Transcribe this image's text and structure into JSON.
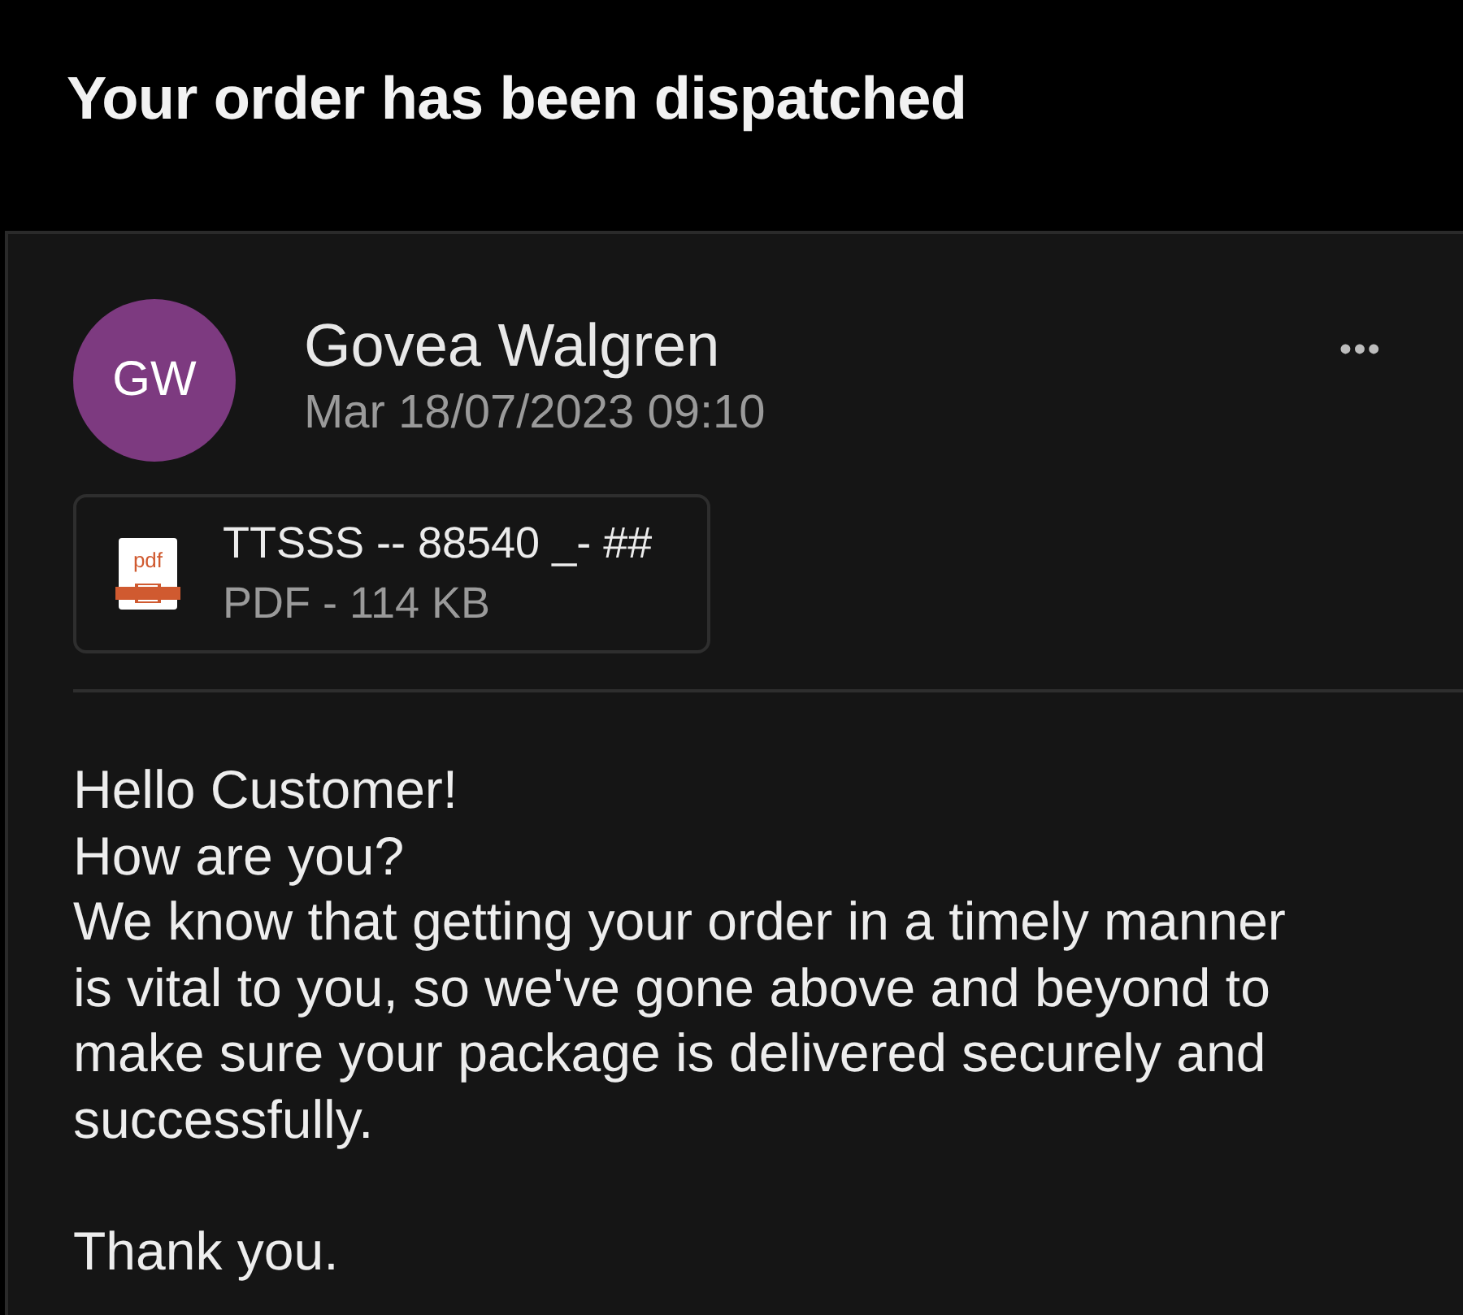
{
  "header": {
    "title": "Your order has been dispatched"
  },
  "message": {
    "sender": {
      "initials": "GW",
      "name": "Govea Walgren",
      "color": "#7d3a80"
    },
    "date": "Mar 18/07/2023 09:10",
    "more_icon": "•••",
    "attachment": {
      "icon_label": "pdf",
      "name": "TTSSS -- 88540 _- ##",
      "meta": "PDF - 114 KB"
    },
    "body": [
      {
        "text": "Hello Customer!",
        "spaced": false
      },
      {
        "text": "How are you?",
        "spaced": false
      },
      {
        "text": "We know that getting your order in a timely manner is vital to you, so we've gone above and beyond to make sure your package is delivered securely and successfully.",
        "spaced": false
      },
      {
        "text": "Thank you.",
        "spaced": true
      }
    ]
  }
}
